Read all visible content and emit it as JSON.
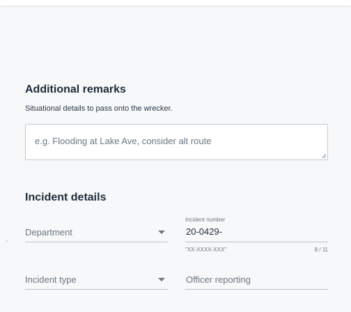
{
  "remarks": {
    "title": "Additional remarks",
    "subtitle": "Situational details to pass onto the wrecker.",
    "placeholder": "e.g. Flooding at Lake Ave, consider alt route"
  },
  "incident": {
    "title": "Incident details",
    "department": {
      "label": "Department",
      "icon": "caret-down-icon"
    },
    "incident_number": {
      "label": "Incident number",
      "value": "20-0429-",
      "hint": "\"XX-XXXX-XXX\"",
      "counter": "8 / 11"
    },
    "incident_type": {
      "label": "Incident type",
      "icon": "caret-down-icon"
    },
    "officer": {
      "placeholder": "Officer reporting"
    }
  },
  "colors": {
    "background": "#f7f8f9",
    "heading": "#1c2b39",
    "muted": "#6b7782",
    "border": "#b9c0c7"
  }
}
